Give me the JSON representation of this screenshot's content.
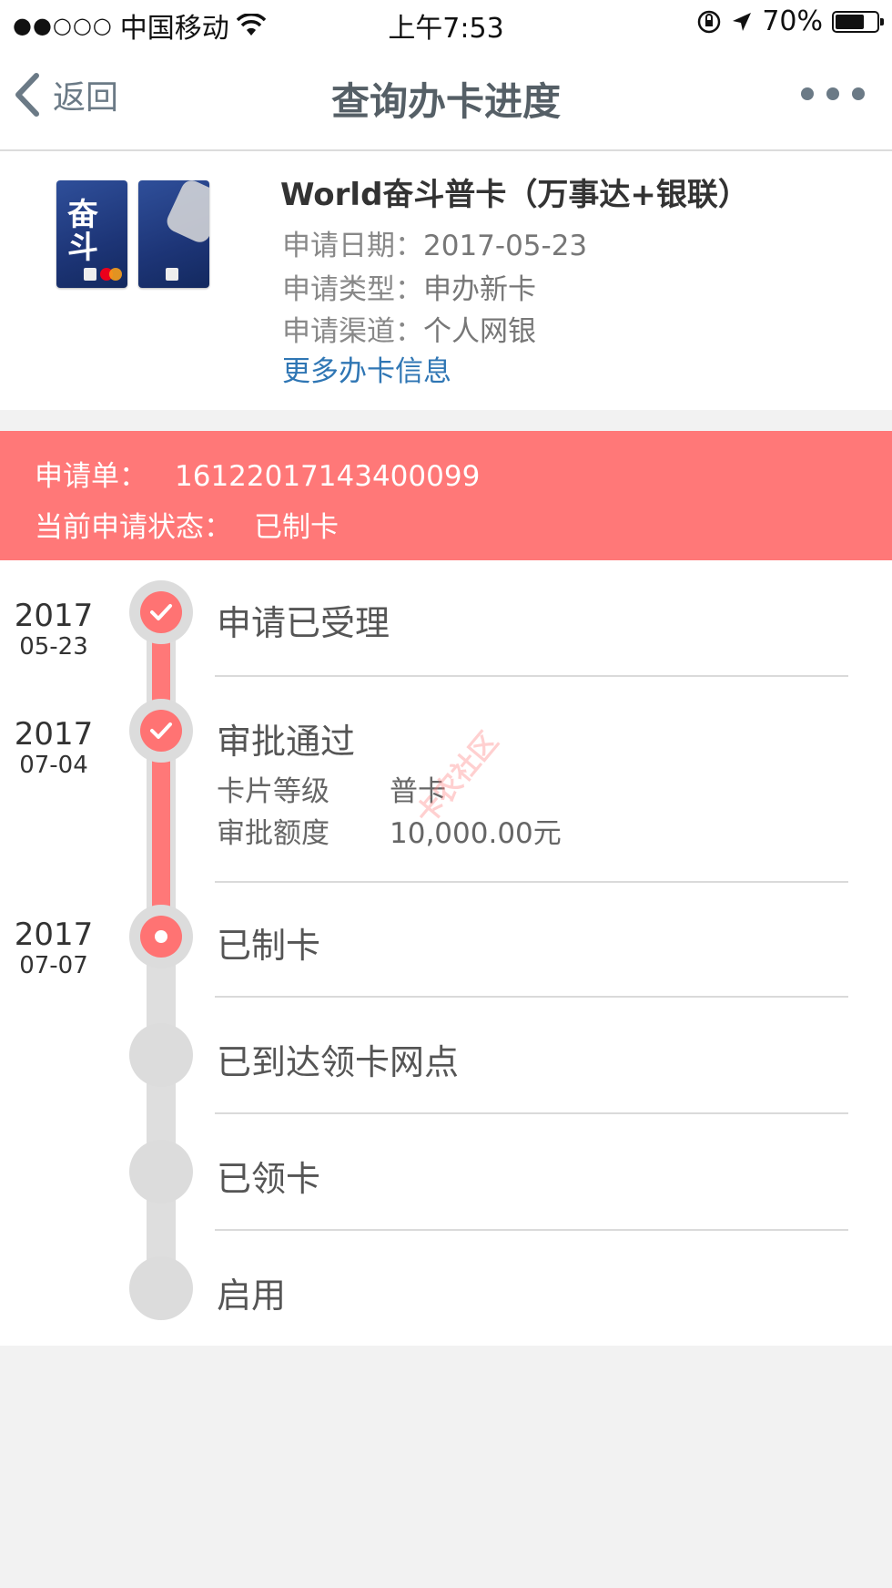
{
  "status_bar": {
    "signal": "●●○○○",
    "carrier": "中国移动",
    "time": "上午7:53",
    "battery": "70%"
  },
  "nav": {
    "back_label": "返回",
    "title": "查询办卡进度"
  },
  "card": {
    "name": "World奋斗普卡（万事达+银联）",
    "fields": [
      {
        "label": "申请日期：",
        "value": "2017-05-23"
      },
      {
        "label": "申请类型：",
        "value": "申办新卡"
      },
      {
        "label": "申请渠道：",
        "value": "个人网银"
      }
    ],
    "more_link": "更多办卡信息"
  },
  "application": {
    "number_label": "申请单：",
    "number": "16122017143400099",
    "status_label": "当前申请状态：",
    "status": "已制卡"
  },
  "steps": [
    {
      "year": "2017",
      "md": "05-23",
      "label": "申请已受理",
      "state": "done"
    },
    {
      "year": "2017",
      "md": "07-04",
      "label": "审批通过",
      "state": "done",
      "details": [
        {
          "key": "卡片等级",
          "value": "普卡"
        },
        {
          "key": "审批额度",
          "value": "10,000.00元"
        }
      ]
    },
    {
      "year": "2017",
      "md": "07-07",
      "label": "已制卡",
      "state": "current"
    },
    {
      "label": "已到达领卡网点",
      "state": "pending"
    },
    {
      "label": "已领卡",
      "state": "pending"
    },
    {
      "label": "启用",
      "state": "pending"
    }
  ],
  "watermark": "卡农社区",
  "colors": {
    "accent": "#ff7878",
    "link": "#2f76b4",
    "pending": "#dcdcdc"
  }
}
